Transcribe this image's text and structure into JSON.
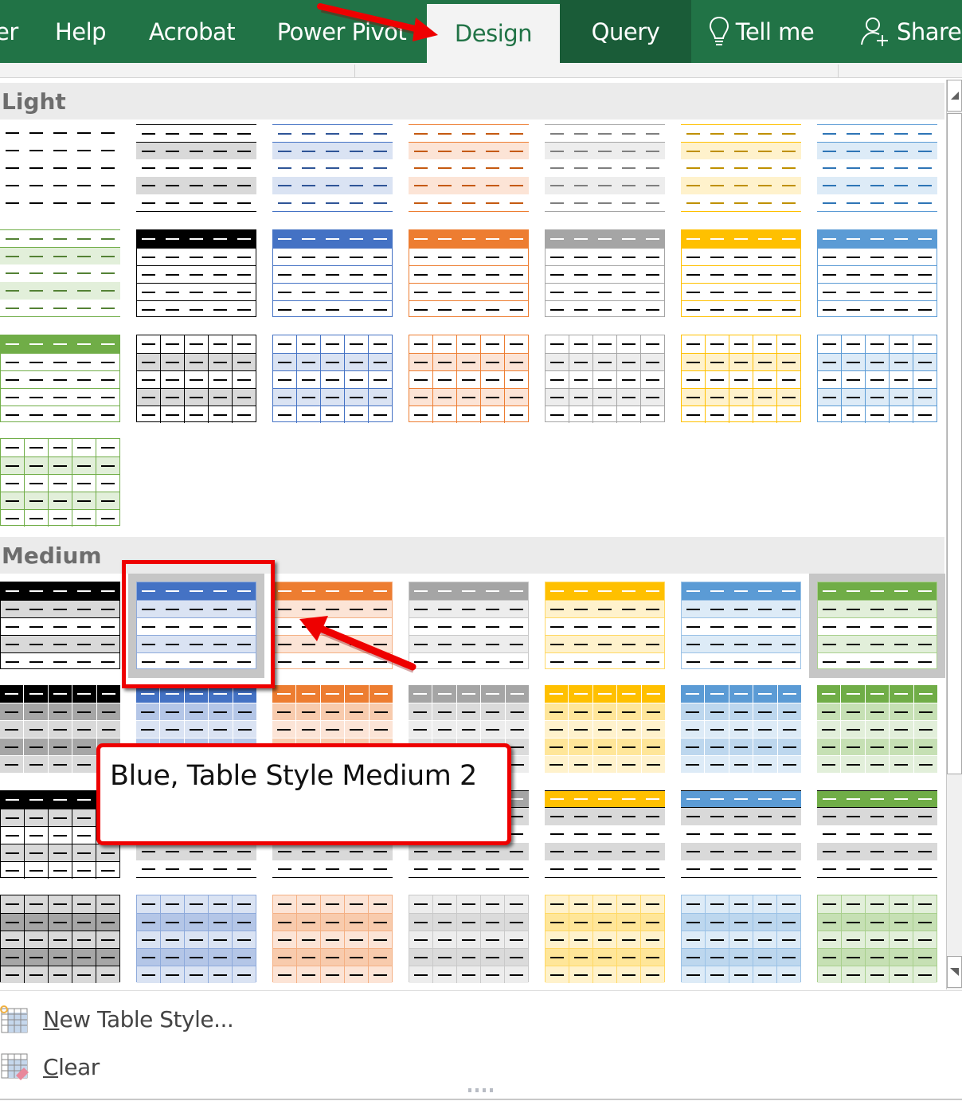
{
  "ribbon": {
    "tabs": [
      {
        "label": "er",
        "state": "normal"
      },
      {
        "label": "Help",
        "state": "normal"
      },
      {
        "label": "Acrobat",
        "state": "normal"
      },
      {
        "label": "Power Pivot",
        "state": "normal"
      },
      {
        "label": "Design",
        "state": "active"
      },
      {
        "label": "Query",
        "state": "contextual"
      },
      {
        "label": "Tell me",
        "state": "normal",
        "icon": "lightbulb-icon"
      },
      {
        "label": "Share",
        "state": "normal",
        "icon": "share-person-icon"
      }
    ],
    "colors": {
      "ribbon_green": "#217346",
      "query_green": "#1a5c38",
      "active_bg": "#f3f3f3"
    }
  },
  "gallery": {
    "sections": [
      {
        "title": "Light"
      },
      {
        "title": "Medium"
      }
    ],
    "light_styles": [
      {
        "kind": "plain-lines",
        "line": "#000000",
        "band": null,
        "dash": "#000000"
      },
      {
        "kind": "banded-rules",
        "line": "#000000",
        "band": "#d9d9d9",
        "dash": "#000000"
      },
      {
        "kind": "banded-rules",
        "line": "#4472c4",
        "band": "#dae3f3",
        "dash": "#2f5597"
      },
      {
        "kind": "banded-rules",
        "line": "#ed7d31",
        "band": "#fce4d6",
        "dash": "#c55a11"
      },
      {
        "kind": "banded-rules",
        "line": "#a5a5a5",
        "band": "#ededed",
        "dash": "#7f7f7f"
      },
      {
        "kind": "banded-rules",
        "line": "#ffc000",
        "band": "#fff2cc",
        "dash": "#bf9000"
      },
      {
        "kind": "banded-rules",
        "line": "#5b9bd5",
        "band": "#ddebf7",
        "dash": "#2e75b6"
      },
      {
        "kind": "banded-rules",
        "line": "#70ad47",
        "band": "#e2efda",
        "dash": "#548235"
      },
      {
        "kind": "header-rows",
        "line": "#000000",
        "head": "#000000",
        "band": null
      },
      {
        "kind": "header-rows",
        "line": "#4472c4",
        "head": "#4472c4",
        "band": null
      },
      {
        "kind": "header-rows",
        "line": "#ed7d31",
        "head": "#ed7d31",
        "band": null
      },
      {
        "kind": "header-rows",
        "line": "#a5a5a5",
        "head": "#a5a5a5",
        "band": null
      },
      {
        "kind": "header-rows",
        "line": "#ffc000",
        "head": "#ffc000",
        "band": null
      },
      {
        "kind": "header-rows",
        "line": "#5b9bd5",
        "head": "#5b9bd5",
        "band": null
      },
      {
        "kind": "header-rows",
        "line": "#70ad47",
        "head": "#70ad47",
        "band": null
      },
      {
        "kind": "grid-banded",
        "line": "#000000",
        "band": "#d9d9d9"
      },
      {
        "kind": "grid-banded",
        "line": "#4472c4",
        "band": "#dae3f3"
      },
      {
        "kind": "grid-banded",
        "line": "#ed7d31",
        "band": "#fce4d6"
      },
      {
        "kind": "grid-banded",
        "line": "#a5a5a5",
        "band": "#ededed"
      },
      {
        "kind": "grid-banded",
        "line": "#ffc000",
        "band": "#fff2cc"
      },
      {
        "kind": "grid-banded",
        "line": "#5b9bd5",
        "band": "#ddebf7"
      },
      {
        "kind": "grid-banded",
        "line": "#70ad47",
        "band": "#e2efda"
      }
    ],
    "medium_styles": [
      {
        "kind": "head-banded",
        "head": "#000000",
        "line": "#000000",
        "band": "#d9d9d9"
      },
      {
        "kind": "head-banded",
        "head": "#4472c4",
        "line": "#8eaadb",
        "band": "#dae3f3",
        "selected": true,
        "name": "Blue, Table Style Medium 2"
      },
      {
        "kind": "head-banded",
        "head": "#ed7d31",
        "line": "#f4b084",
        "band": "#fce4d6"
      },
      {
        "kind": "head-banded",
        "head": "#a5a5a5",
        "line": "#c9c9c9",
        "band": "#ededed"
      },
      {
        "kind": "head-banded",
        "head": "#ffc000",
        "line": "#ffd966",
        "band": "#fff2cc"
      },
      {
        "kind": "head-banded",
        "head": "#5b9bd5",
        "line": "#9bc2e6",
        "band": "#ddebf7"
      },
      {
        "kind": "head-banded",
        "head": "#70ad47",
        "line": "#a9d08e",
        "band": "#e2efda",
        "hovered": true
      },
      {
        "kind": "white-grid",
        "head": "#000000",
        "band1": "#a6a6a6",
        "band2": "#d9d9d9"
      },
      {
        "kind": "white-grid",
        "head": "#4472c4",
        "band1": "#b4c6e7",
        "band2": "#dae3f3"
      },
      {
        "kind": "white-grid",
        "head": "#ed7d31",
        "band1": "#f8cbad",
        "band2": "#fce4d6"
      },
      {
        "kind": "white-grid",
        "head": "#a5a5a5",
        "band1": "#dbdbdb",
        "band2": "#ededed"
      },
      {
        "kind": "white-grid",
        "head": "#ffc000",
        "band1": "#ffe699",
        "band2": "#fff2cc"
      },
      {
        "kind": "white-grid",
        "head": "#5b9bd5",
        "band1": "#bdd7ee",
        "band2": "#ddebf7"
      },
      {
        "kind": "white-grid",
        "head": "#70ad47",
        "band1": "#c6e0b4",
        "band2": "#e2efda"
      },
      {
        "kind": "black-grid-head",
        "head": "#000000",
        "band": "#d9d9d9"
      },
      {
        "kind": "rule-head",
        "head": "#4472c4",
        "band": "#d9d9d9"
      },
      {
        "kind": "rule-head",
        "head": "#ed7d31",
        "band": "#d9d9d9"
      },
      {
        "kind": "rule-head",
        "head": "#a5a5a5",
        "band": "#d9d9d9"
      },
      {
        "kind": "rule-head",
        "head": "#ffc000",
        "band": "#d9d9d9"
      },
      {
        "kind": "rule-head",
        "head": "#5b9bd5",
        "band": "#d9d9d9"
      },
      {
        "kind": "rule-head",
        "head": "#70ad47",
        "band": "#d9d9d9"
      },
      {
        "kind": "full-grid",
        "line": "#000000",
        "band1": "#d9d9d9",
        "band2": "#a6a6a6"
      },
      {
        "kind": "full-grid",
        "line": "#8eaadb",
        "band1": "#dae3f3",
        "band2": "#b4c6e7"
      },
      {
        "kind": "full-grid",
        "line": "#f4b084",
        "band1": "#fce4d6",
        "band2": "#f8cbad"
      },
      {
        "kind": "full-grid",
        "line": "#c9c9c9",
        "band1": "#ededed",
        "band2": "#dbdbdb"
      },
      {
        "kind": "full-grid",
        "line": "#ffd966",
        "band1": "#fff2cc",
        "band2": "#ffe699"
      },
      {
        "kind": "full-grid",
        "line": "#9bc2e6",
        "band1": "#ddebf7",
        "band2": "#bdd7ee"
      },
      {
        "kind": "full-grid",
        "line": "#a9d08e",
        "band1": "#e2efda",
        "band2": "#c6e0b4"
      }
    ]
  },
  "tooltip": {
    "text": "Blue, Table Style Medium 2"
  },
  "menu": {
    "new_style": {
      "mnemonic": "N",
      "rest": "ew Table Style..."
    },
    "clear": {
      "mnemonic": "C",
      "rest": "lear"
    }
  },
  "annotations": {
    "color": "#ee0000"
  }
}
